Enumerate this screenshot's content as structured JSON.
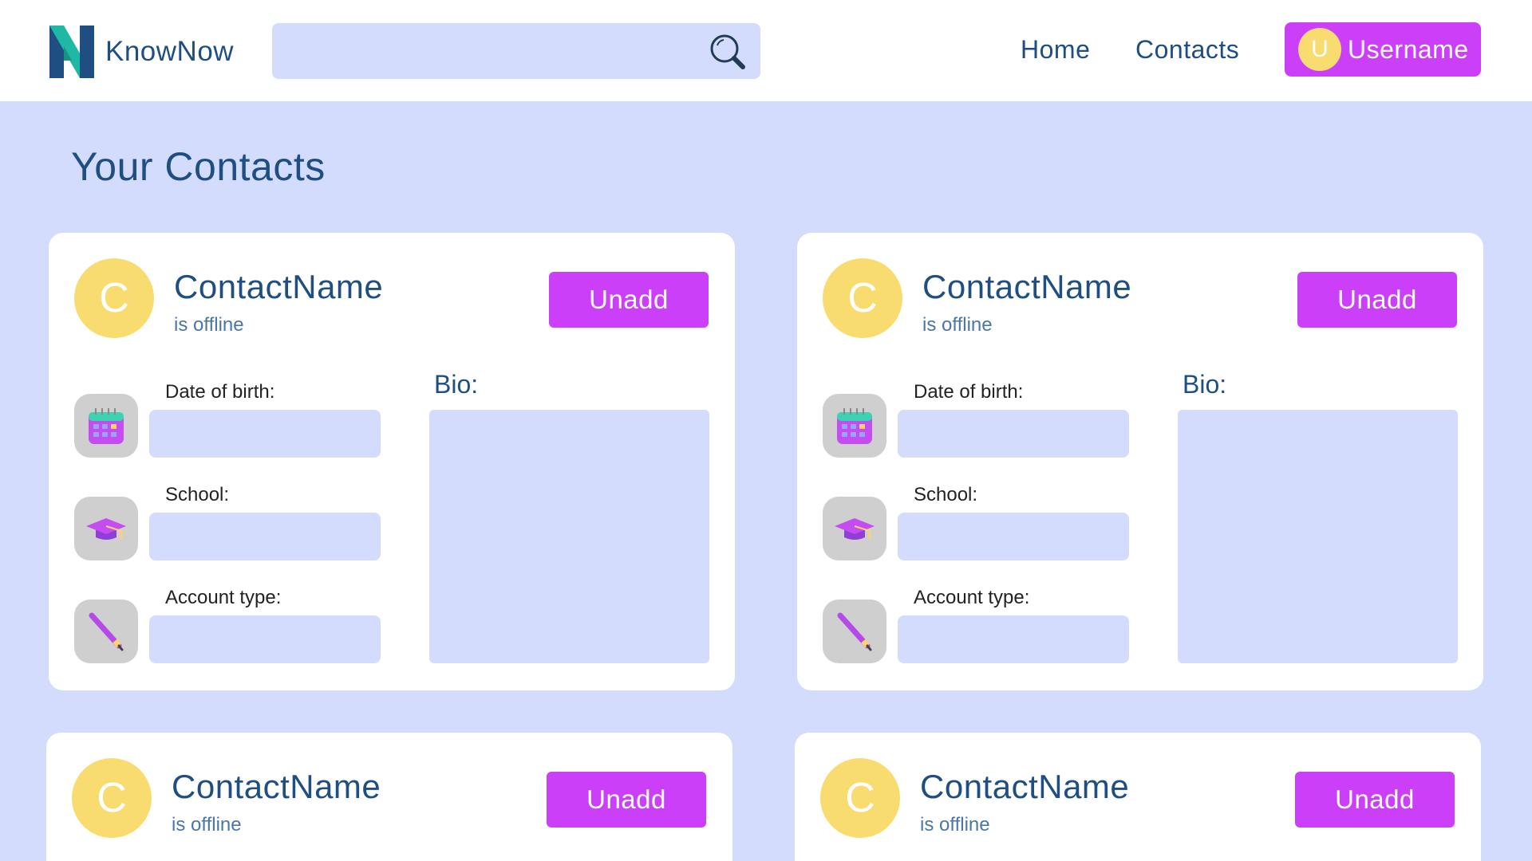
{
  "brand": {
    "name": "KnowNow"
  },
  "search": {
    "placeholder": "",
    "value": ""
  },
  "nav": {
    "home": "Home",
    "contacts": "Contacts"
  },
  "user": {
    "initial": "U",
    "name": "Username"
  },
  "page": {
    "title": "Your Contacts"
  },
  "fields": {
    "dob_label": "Date of birth:",
    "school_label": "School:",
    "account_label": "Account type:",
    "bio_label": "Bio:"
  },
  "contacts": [
    {
      "initial": "C",
      "name": "ContactName",
      "status": "is offline",
      "button": "Unadd",
      "dob": "",
      "school": "",
      "account_type": "",
      "bio": ""
    },
    {
      "initial": "C",
      "name": "ContactName",
      "status": "is offline",
      "button": "Unadd",
      "dob": "",
      "school": "",
      "account_type": "",
      "bio": ""
    },
    {
      "initial": "C",
      "name": "ContactName",
      "status": "is offline",
      "button": "Unadd"
    },
    {
      "initial": "C",
      "name": "ContactName",
      "status": "is offline",
      "button": "Unadd"
    }
  ],
  "icons": {
    "search": "magnifier-icon",
    "dob": "calendar-icon",
    "school": "graduation-cap-icon",
    "account": "pencil-icon"
  },
  "colors": {
    "background": "#d4dcfd",
    "accent": "#cc3ff9",
    "avatar": "#f9dc6f",
    "text": "#1f4f82"
  }
}
